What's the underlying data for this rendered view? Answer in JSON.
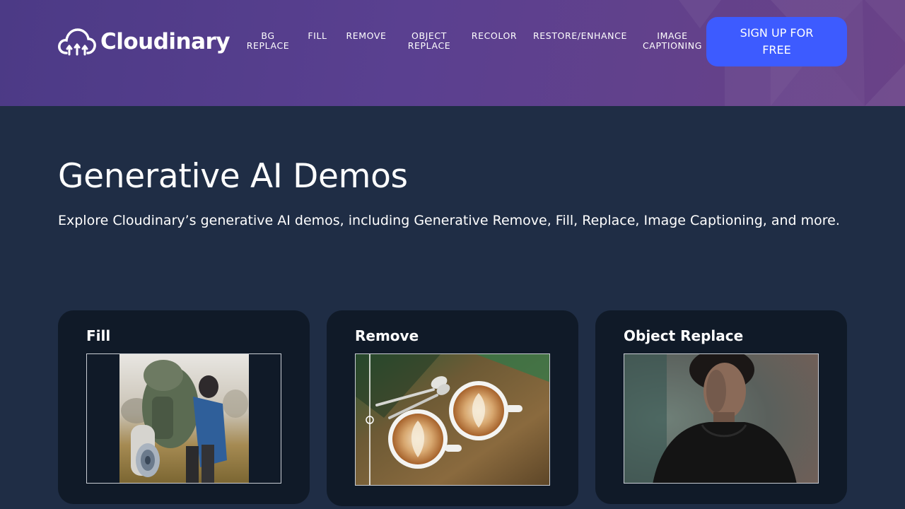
{
  "brand": {
    "name": "Cloudinary",
    "logo_icon": "cloud-logo-icon"
  },
  "nav": {
    "items": [
      {
        "label": "BG REPLACE"
      },
      {
        "label": "FILL"
      },
      {
        "label": "REMOVE"
      },
      {
        "label": "OBJECT REPLACE"
      },
      {
        "label": "RECOLOR"
      },
      {
        "label": "RESTORE/ENHANCE"
      },
      {
        "label": "IMAGE CAPTIONING"
      }
    ],
    "signup_label": "SIGN UP FOR FREE"
  },
  "hero": {
    "title": "Generative AI Demos",
    "description": "Explore Cloudinary’s generative AI demos, including Generative Remove, Fill, Replace, Image Captioning, and more."
  },
  "cards": [
    {
      "title": "Fill",
      "image_alt": "hiker-with-backpack-photo"
    },
    {
      "title": "Remove",
      "image_alt": "latte-cups-on-wooden-table-photo"
    },
    {
      "title": "Object Replace",
      "image_alt": "young-man-in-black-hoodie-portrait-photo"
    }
  ],
  "colors": {
    "header_start": "#4c3a86",
    "header_end": "#6a4287",
    "page_bg": "#1f2d45",
    "card_bg": "#101a28",
    "signup_bg": "#3d5bff"
  }
}
